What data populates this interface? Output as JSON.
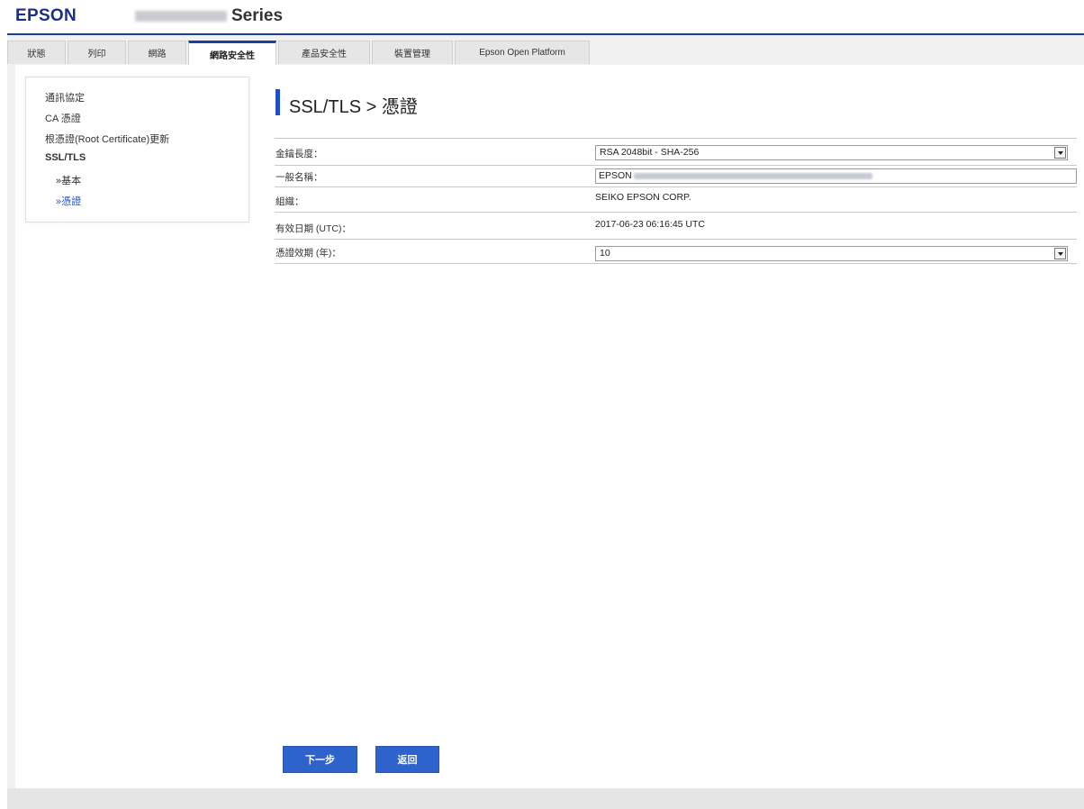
{
  "header": {
    "brand": "EPSON",
    "series": "Series"
  },
  "tabs": [
    {
      "label": "狀態",
      "active": false
    },
    {
      "label": "列印",
      "active": false
    },
    {
      "label": "網路",
      "active": false
    },
    {
      "label": "網路安全性",
      "active": true
    },
    {
      "label": "產品安全性",
      "active": false
    },
    {
      "label": "裝置管理",
      "active": false
    },
    {
      "label": "Epson Open Platform",
      "active": false
    }
  ],
  "sidebar": {
    "items": [
      {
        "label": "通訊協定"
      },
      {
        "label": "CA 憑證"
      },
      {
        "label": "根憑證(Root Certificate)更新"
      },
      {
        "label": "SSL/TLS"
      },
      {
        "label": "»基本"
      },
      {
        "label": "»憑證"
      }
    ]
  },
  "page": {
    "title": "SSL/TLS > 憑證"
  },
  "form": {
    "key_length": {
      "label": "金鑰長度：",
      "value": "RSA 2048bit - SHA-256"
    },
    "common_name": {
      "label": "一般名稱：",
      "value": "EPSON"
    },
    "organization": {
      "label": "組織：",
      "value": "SEIKO EPSON CORP."
    },
    "valid_date": {
      "label": "有效日期 (UTC)：",
      "value": "2017-06-23 06:16:45 UTC"
    },
    "cert_validity": {
      "label": "憑證效期 (年)：",
      "value": "10"
    }
  },
  "buttons": {
    "next": "下一步",
    "back": "返回"
  },
  "colors": {
    "accent": "#1e4fc9",
    "brand": "#1b2f8a",
    "button": "#2f63cc"
  }
}
